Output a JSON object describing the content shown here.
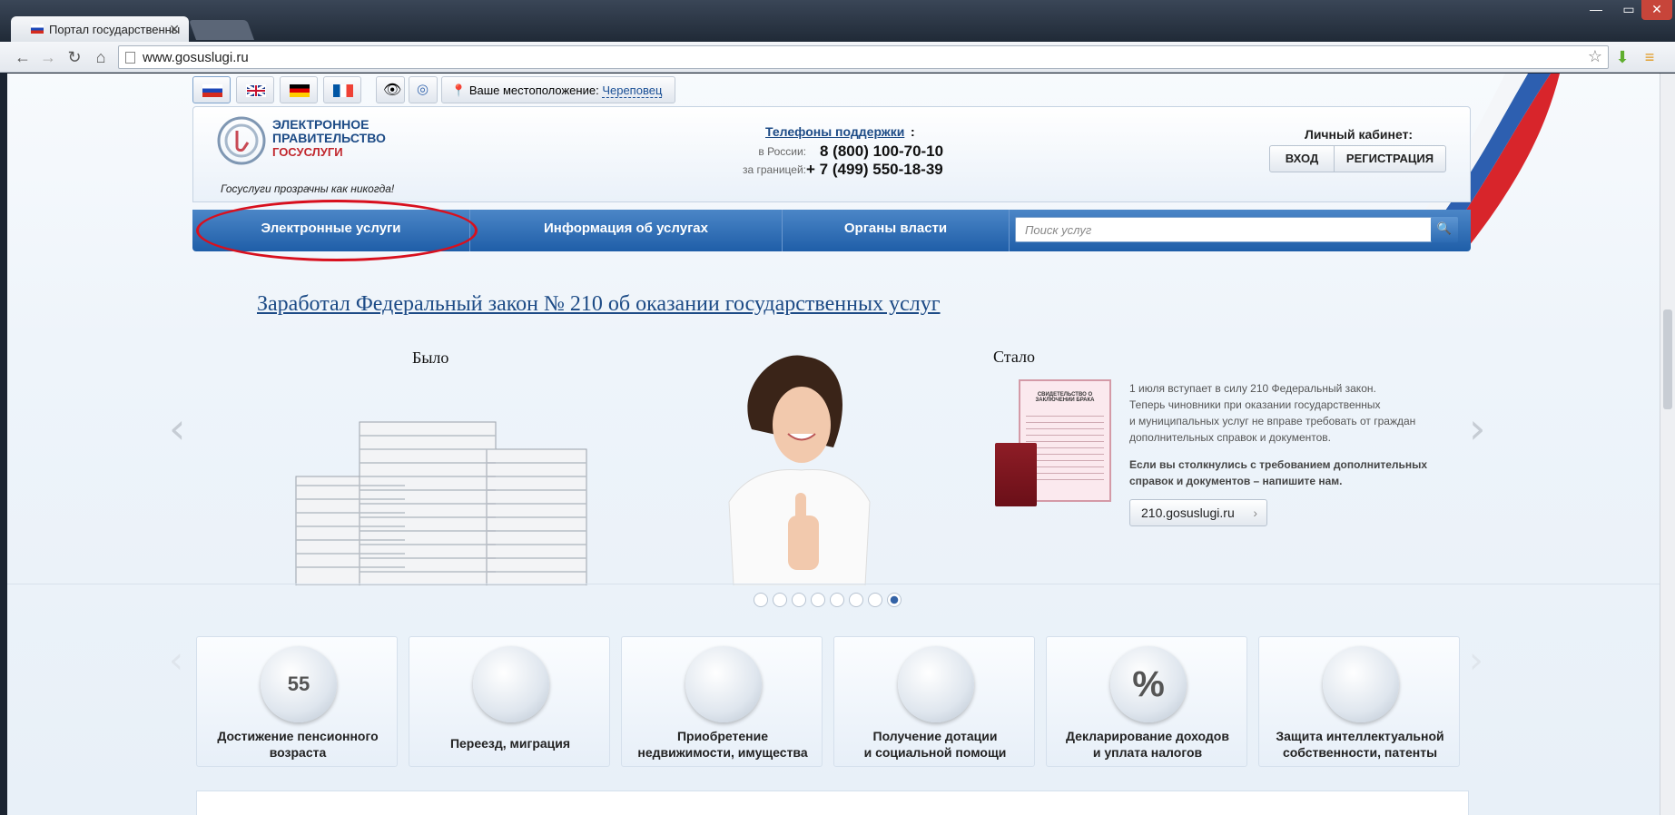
{
  "browser": {
    "tab_title": "Портал государственны",
    "url": "www.gosuslugi.ru"
  },
  "header": {
    "location_label": "Ваше местоположение:",
    "location_value": "Череповец",
    "logo_line1": "ЭЛЕКТРОННОЕ",
    "logo_line2": "ПРАВИТЕЛЬСТВО",
    "logo_line3": "ГОСУСЛУГИ",
    "slogan": "Госуслуги прозрачны как никогда!",
    "support_title": "Телефоны поддержки",
    "phone_ru_label": "в России:",
    "phone_ru": "8 (800) 100-70-10",
    "phone_abroad_label": "за границей:",
    "phone_abroad": "+ 7 (499) 550-18-39",
    "cabinet_title": "Личный кабинет:",
    "login_label": "ВХОД",
    "register_label": "РЕГИСТРАЦИЯ"
  },
  "nav": {
    "items": [
      "Электронные услуги",
      "Информация об услугах",
      "Органы власти"
    ],
    "search_placeholder": "Поиск услуг"
  },
  "slider": {
    "headline": "Заработал Федеральный закон № 210 об оказании государственных услуг",
    "before_label": "Было",
    "after_label": "Стало",
    "text1": "1 июля вступает в силу 210 Федеральный закон.",
    "text2": "Теперь чиновники при оказании государственных",
    "text3": "и муниципальных услуг не вправе требовать от граждан",
    "text4": "дополнительных справок и документов.",
    "text5": "Если вы столкнулись с требованием дополнительных",
    "text6": "справок и документов – напишите нам.",
    "link": "210.gosuslugi.ru",
    "doc_title": "СВИДЕТЕЛЬСТВО О ЗАКЛЮЧЕНИИ БРАКА",
    "dots_total": 8,
    "active_dot": 8
  },
  "tiles": [
    {
      "line1": "Достижение пенсионного",
      "line2": "возраста",
      "icon": "calendar-icon",
      "glyph": "55"
    },
    {
      "line1": "Переезд, миграция",
      "line2": "",
      "icon": "passport-icon",
      "glyph": ""
    },
    {
      "line1": "Приобретение",
      "line2": "недвижимости, имущества",
      "icon": "keys-icon",
      "glyph": ""
    },
    {
      "line1": "Получение дотации",
      "line2": "и социальной помощи",
      "icon": "lifebuoy-icon",
      "glyph": ""
    },
    {
      "line1": "Декларирование доходов",
      "line2": "и уплата налогов",
      "icon": "percent-icon",
      "glyph": "%"
    },
    {
      "line1": "Защита интеллектуальной",
      "line2": "собственности, патенты",
      "icon": "certificate-icon",
      "glyph": ""
    }
  ]
}
